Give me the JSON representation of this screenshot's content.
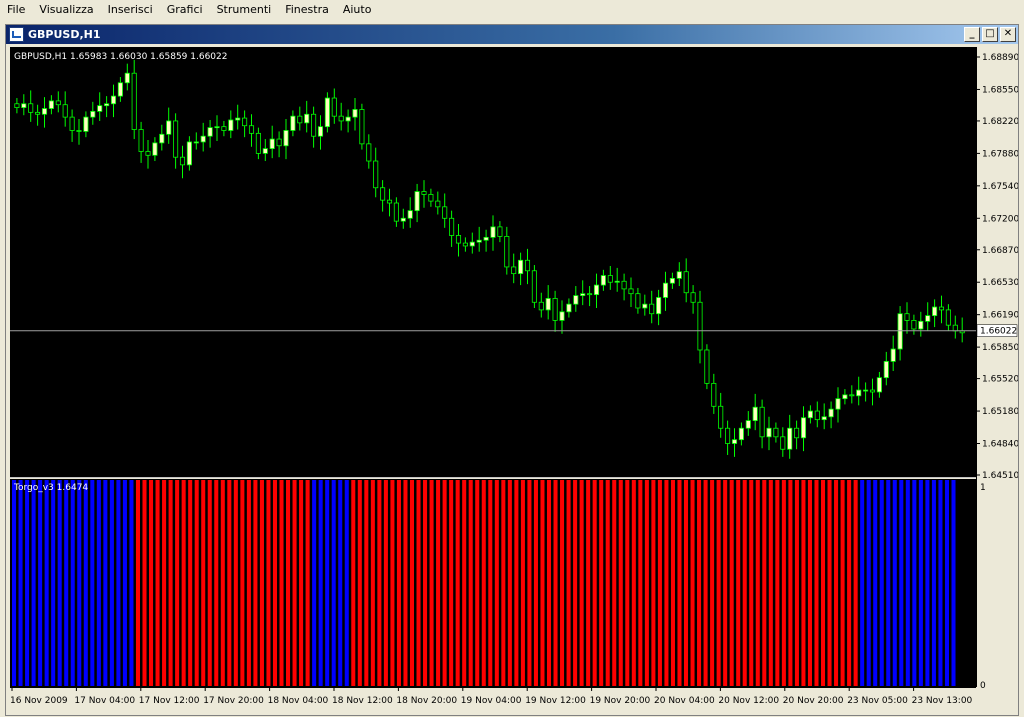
{
  "menu": [
    "File",
    "Visualizza",
    "Inserisci",
    "Grafici",
    "Strumenti",
    "Finestra",
    "Aiuto"
  ],
  "window": {
    "title": "GBPUSD,H1",
    "minimize_glyph": "_",
    "restore_glyph": "□",
    "close_glyph": "✕"
  },
  "price_chart": {
    "header": "GBPUSD,H1  1.65983 1.66030 1.65859 1.66022",
    "y_ticks": [
      "1.68890",
      "1.68550",
      "1.68220",
      "1.67880",
      "1.67540",
      "1.67200",
      "1.66870",
      "1.66530",
      "1.66190",
      "1.65850",
      "1.65520",
      "1.65180",
      "1.64840",
      "1.64510"
    ],
    "y_tick_values": [
      1.6889,
      1.6855,
      1.6822,
      1.6788,
      1.6754,
      1.672,
      1.6687,
      1.6653,
      1.6619,
      1.6585,
      1.6552,
      1.6518,
      1.6484,
      1.6451
    ],
    "current_price_label": "1.66022",
    "current_price": 1.66022
  },
  "indicator": {
    "header": "Torgo_v3 1.6474",
    "y_top_label": "1",
    "y_bottom_label": "0"
  },
  "x_axis": {
    "labels": [
      "16 Nov 2009",
      "17 Nov 04:00",
      "17 Nov 12:00",
      "17 Nov 20:00",
      "18 Nov 04:00",
      "18 Nov 12:00",
      "18 Nov 20:00",
      "19 Nov 04:00",
      "19 Nov 12:00",
      "19 Nov 20:00",
      "20 Nov 04:00",
      "20 Nov 12:00",
      "20 Nov 20:00",
      "23 Nov 05:00",
      "23 Nov 13:00"
    ]
  },
  "colors": {
    "background": "#000000",
    "bull_candle": "#ffffc0",
    "bear_candle": "#000000",
    "wick": "#00ff00",
    "histogram_blue": "#0000ff",
    "histogram_red": "#ff0000",
    "axis_text": "#000000"
  },
  "chart_data": {
    "type": "candlestick",
    "series": [
      {
        "name": "GBPUSD,H1",
        "ohlc_close_path": [
          1.6836,
          1.684,
          1.6831,
          1.6829,
          1.6835,
          1.6843,
          1.6839,
          1.6826,
          1.6812,
          1.6811,
          1.6826,
          1.6832,
          1.6838,
          1.684,
          1.6848,
          1.6862,
          1.6872,
          1.6813,
          1.679,
          1.6786,
          1.6799,
          1.6808,
          1.6822,
          1.6784,
          1.6776,
          1.68,
          1.68,
          1.6806,
          1.6815,
          1.6816,
          1.6812,
          1.6823,
          1.6825,
          1.6817,
          1.6809,
          1.6788,
          1.6793,
          1.6803,
          1.6796,
          1.6812,
          1.6827,
          1.682,
          1.6829,
          1.6806,
          1.6816,
          1.6846,
          1.6827,
          1.6822,
          1.6826,
          1.6834,
          1.6798,
          1.678,
          1.6752,
          1.6739,
          1.6736,
          1.6717,
          1.672,
          1.6728,
          1.6748,
          1.6745,
          1.6738,
          1.6732,
          1.672,
          1.6702,
          1.6694,
          1.6691,
          1.6695,
          1.6697,
          1.67,
          1.6711,
          1.6701,
          1.6669,
          1.6662,
          1.6676,
          1.6665,
          1.6632,
          1.6624,
          1.6636,
          1.6613,
          1.6622,
          1.663,
          1.6639,
          1.6641,
          1.664,
          1.665,
          1.666,
          1.6653,
          1.6654,
          1.6646,
          1.6641,
          1.6626,
          1.663,
          1.662,
          1.6637,
          1.6652,
          1.6657,
          1.6664,
          1.6642,
          1.6632,
          1.6582,
          1.6547,
          1.6523,
          1.65,
          1.6484,
          1.6488,
          1.65,
          1.6508,
          1.6522,
          1.6491,
          1.65,
          1.6491,
          1.6478,
          1.65,
          1.649,
          1.6511,
          1.6518,
          1.6509,
          1.6512,
          1.652,
          1.6531,
          1.6535,
          1.6534,
          1.654,
          1.654,
          1.6538,
          1.6553,
          1.657,
          1.6583,
          1.662,
          1.6613,
          1.6604,
          1.6612,
          1.6618,
          1.6627,
          1.6624,
          1.6608,
          1.6602,
          1.66
        ]
      },
      {
        "name": "Torgo_v3",
        "state_runs": [
          [
            "blue",
            19
          ],
          [
            "red",
            27
          ],
          [
            "blue",
            6
          ],
          [
            "red",
            78
          ],
          [
            "blue",
            15
          ]
        ]
      }
    ]
  }
}
